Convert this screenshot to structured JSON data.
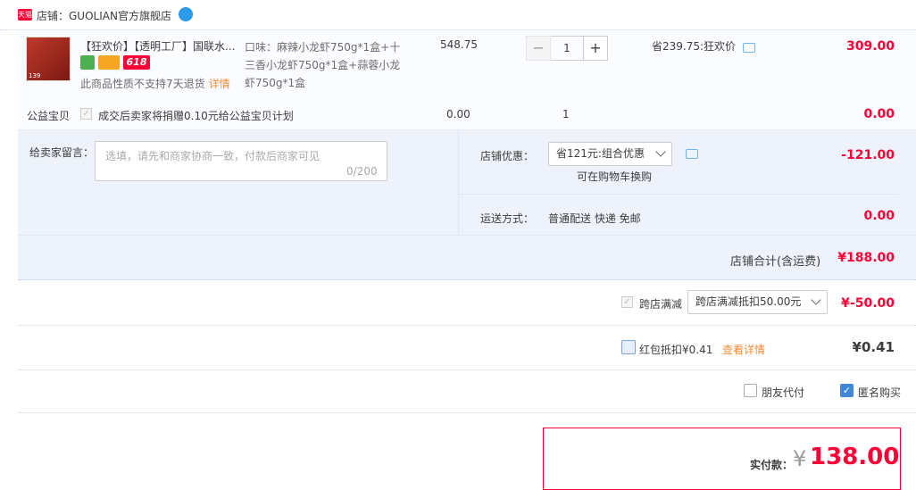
{
  "shop": {
    "logo": "天猫",
    "label": "店铺：GUOLIAN官方旗舰店"
  },
  "item": {
    "thumb_tag": "139",
    "title": "【狂欢价】【透明工厂】国联水...",
    "promo_badge": "618",
    "no_return": "此商品性质不支持7天退货",
    "detail_link": "详情",
    "sku": "口味：麻辣小龙虾750g*1盒+十三香小龙虾750g*1盒+蒜蓉小龙虾750g*1盒",
    "unit_price": "548.75",
    "qty_minus": "−",
    "qty": "1",
    "qty_plus": "+",
    "saving": "省239.75:狂欢价",
    "total": "309.00"
  },
  "charity": {
    "label": "公益宝贝",
    "check": "✓",
    "text": "成交后卖家将捐赠0.10元给公益宝贝计划",
    "price": "0.00",
    "qty": "1",
    "total": "0.00"
  },
  "options": {
    "message_label": "给卖家留言：",
    "message_placeholder": "选填，请先和商家协商一致，付款后商家可见",
    "message_count": "0/200",
    "coupon_label": "店铺优惠：",
    "coupon_value": "省121元:组合优惠",
    "coupon_sub": "可在购物车换购",
    "coupon_amount": "-121.00",
    "shipping_label": "运送方式：",
    "shipping_value": "普通配送 快递 免邮",
    "shipping_amount": "0.00",
    "shop_total_label": "店铺合计(含运费)",
    "shop_total": "¥188.00"
  },
  "cross_store": {
    "check": "✓",
    "label": "跨店满减",
    "select_value": "跨店满减抵扣50.00元",
    "amount": "¥-50.00"
  },
  "red_packet": {
    "label": "红包抵扣¥0.41",
    "link": "查看详情",
    "amount": "¥0.41"
  },
  "payment_options": {
    "friend_pay": "朋友代付",
    "anonymous": "匿名购买",
    "anon_check": "✓"
  },
  "pay": {
    "label": "实付款：",
    "symbol": "¥",
    "amount": "138.00"
  },
  "colors": {
    "accent_red": "#ff0036",
    "link_orange": "#f08c32",
    "panel_blue": "#eef3fb"
  }
}
